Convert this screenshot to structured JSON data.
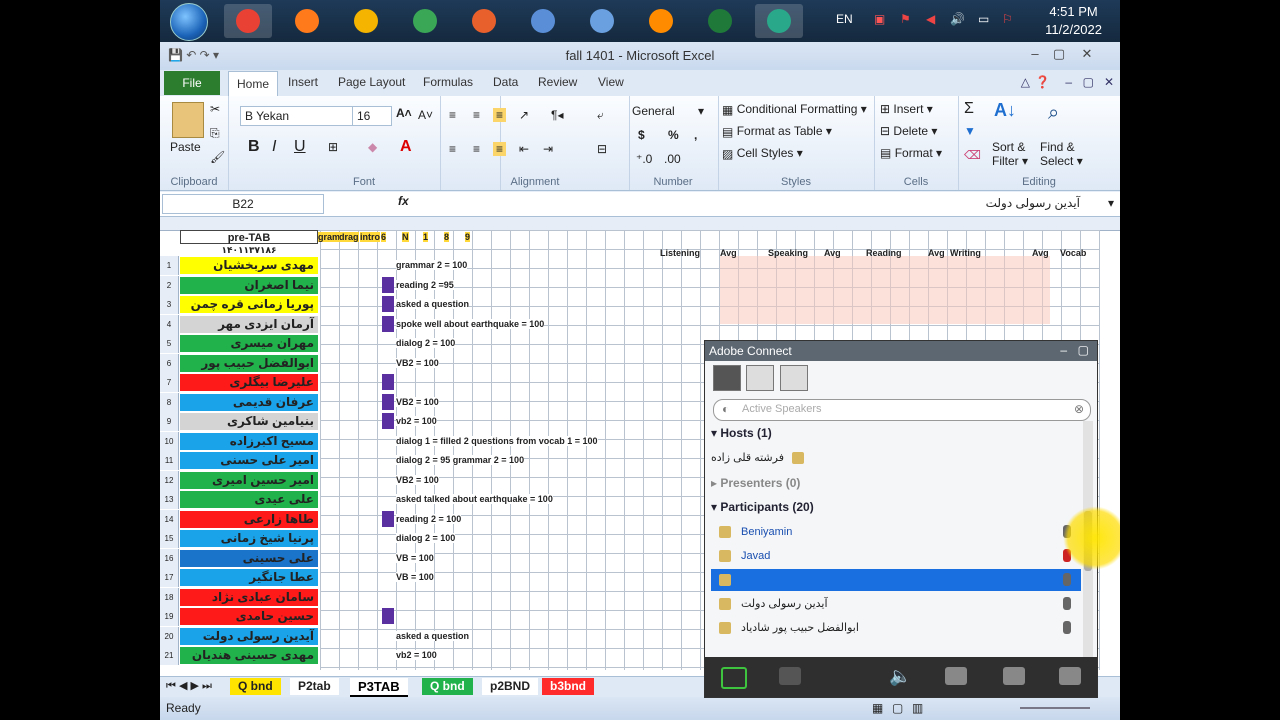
{
  "taskbar": {
    "lang": "EN",
    "time": "4:51 PM",
    "date": "11/2/2022",
    "apps": [
      {
        "name": "chrome-icon",
        "color": "#e94235"
      },
      {
        "name": "firefox-icon",
        "color": "#ff7a1a"
      },
      {
        "name": "app-icon",
        "color": "#f4b400"
      },
      {
        "name": "calculator-icon",
        "color": "#3aa757"
      },
      {
        "name": "paint-icon",
        "color": "#e8602c"
      },
      {
        "name": "tape-icon",
        "color": "#5a8fd8"
      },
      {
        "name": "computer-icon",
        "color": "#6aa0e0"
      },
      {
        "name": "vlc-icon",
        "color": "#ff8c00"
      },
      {
        "name": "excel-icon",
        "color": "#1f7a3a"
      },
      {
        "name": "snipping-icon",
        "color": "#2aa88a"
      }
    ]
  },
  "window": {
    "title": "fall 1401 - Microsoft Excel"
  },
  "ribbon": {
    "tabs": [
      "File",
      "Home",
      "Insert",
      "Page Layout",
      "Formulas",
      "Data",
      "Review",
      "View"
    ],
    "clipboard": {
      "paste": "Paste",
      "label": "Clipboard"
    },
    "font": {
      "name": "B Yekan",
      "size": "16",
      "bold": "B",
      "italic": "I",
      "underline": "U",
      "label": "Font"
    },
    "alignment": {
      "label": "Alignment"
    },
    "number": {
      "format": "General",
      "currency": "$",
      "percent": "%",
      "comma": ",",
      "label": "Number"
    },
    "styles": {
      "conditional": "Conditional Formatting",
      "format_table": "Format as Table",
      "cell_styles": "Cell Styles",
      "label": "Styles"
    },
    "cells": {
      "insert": "Insert",
      "delete": "Delete",
      "format": "Format",
      "label": "Cells"
    },
    "editing": {
      "sigma": "Σ",
      "sort": "Sort &",
      "filter": "Filter",
      "find": "Find &",
      "select": "Select",
      "label": "Editing"
    }
  },
  "formula_bar": {
    "name_box": "B22",
    "fx": "fx",
    "content": "آیدین رسولی دولت"
  },
  "sheet": {
    "header1": "pre-TAB",
    "header2": "۱۴۰۱۱۳۷۱۸۶",
    "top_marks": [
      "grammar",
      "drag",
      "intro",
      "6",
      "N",
      "1",
      "8",
      "9"
    ],
    "sections": [
      "Listening",
      "Avg",
      "Speaking",
      "Avg",
      "Reading",
      "Avg",
      "Writing",
      "Avg",
      "Vocab"
    ],
    "rows": [
      {
        "n": "1",
        "name": "مهدی سربخشیان",
        "color": "yel",
        "note": "grammar 2 = 100"
      },
      {
        "n": "2",
        "name": "نیما اصغران",
        "color": "grn",
        "note": "reading 2 =95"
      },
      {
        "n": "3",
        "name": "پوریا زمانی قره چمن",
        "color": "yel",
        "note": "asked a question"
      },
      {
        "n": "4",
        "name": "آرمان ایزدی مهر",
        "color": "gry",
        "note": "spoke well about earthquake = 100"
      },
      {
        "n": "5",
        "name": "مهران میسری",
        "color": "grn",
        "note": "dialog 2 = 100"
      },
      {
        "n": "6",
        "name": "ابوالفضل حبیب پور",
        "color": "grn",
        "note": "VB2 = 100"
      },
      {
        "n": "7",
        "name": "علیرضا بیگلری",
        "color": "red",
        "note": ""
      },
      {
        "n": "8",
        "name": "عرفان قدیمی",
        "color": "blu",
        "note": "VB2 = 100"
      },
      {
        "n": "9",
        "name": "بنیامین شاکری",
        "color": "gry",
        "note": "vb2 = 100"
      },
      {
        "n": "10",
        "name": "مسیح اکبرزاده",
        "color": "blu",
        "note": "dialog 1 = filled 2 questions from vocab 1 = 100"
      },
      {
        "n": "11",
        "name": "امیر علی حسنی",
        "color": "blu",
        "note": "dialog 2 = 95 grammar 2 = 100"
      },
      {
        "n": "12",
        "name": "امیر حسین امیری",
        "color": "grn",
        "note": "VB2 = 100"
      },
      {
        "n": "13",
        "name": "علی عیدی",
        "color": "grn",
        "note": "asked talked about earthquake = 100"
      },
      {
        "n": "14",
        "name": "طاها زارعی",
        "color": "red",
        "note": "reading 2 = 100"
      },
      {
        "n": "15",
        "name": "پرنیا شیخ زمانی",
        "color": "blu",
        "note": "dialog 2 = 100"
      },
      {
        "n": "16",
        "name": "علی حسینی",
        "color": "dkb",
        "note": "VB = 100"
      },
      {
        "n": "17",
        "name": "عطا جانگیر",
        "color": "blu",
        "note": "VB = 100"
      },
      {
        "n": "18",
        "name": "سامان عبادی نژاد",
        "color": "red",
        "note": ""
      },
      {
        "n": "19",
        "name": "حسین حامدی",
        "color": "red",
        "note": ""
      },
      {
        "n": "20",
        "name": "آیدین رسولی دولت",
        "color": "blu",
        "note": "asked a question"
      },
      {
        "n": "21",
        "name": "مهدی حسینی هندیان",
        "color": "grn",
        "note": "vb2 = 100"
      }
    ],
    "tabs": [
      "Q bnd",
      "P2tab",
      "P3TAB",
      "Q bnd",
      "p2BND",
      "b3bnd"
    ]
  },
  "status": {
    "ready": "Ready"
  },
  "adobe_connect": {
    "title": "Adobe Connect",
    "search_placeholder": "Active Speakers",
    "hosts_label": "Hosts (1)",
    "host_name": "فرشته قلی زاده",
    "presenters_label": "Presenters (0)",
    "participants_label": "Participants (20)",
    "participants": [
      "Beniyamin",
      "Javad",
      "",
      "آیدین رسولی دولت",
      "ابوالفضل حبیب پور شادیاد"
    ]
  },
  "colors": {
    "excel_green": "#2d7d2f",
    "selection_blue": "#1a6fe0",
    "accent_yellow": "#ffe400"
  }
}
